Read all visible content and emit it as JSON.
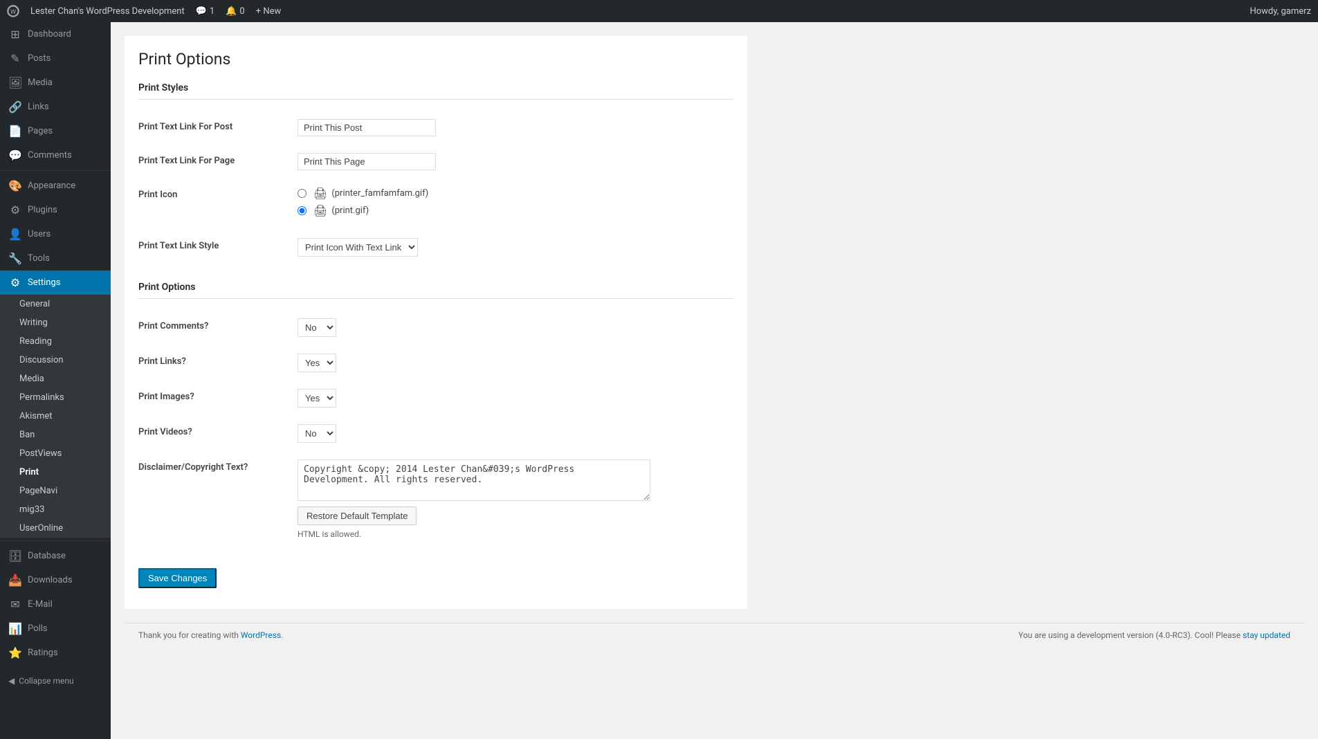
{
  "adminbar": {
    "site_name": "Lester Chan's WordPress Development",
    "comments_count": "1",
    "updates_count": "0",
    "new_label": "+ New",
    "howdy": "Howdy, gamerz"
  },
  "sidebar": {
    "menu_items": [
      {
        "id": "dashboard",
        "label": "Dashboard",
        "icon": "⊞"
      },
      {
        "id": "posts",
        "label": "Posts",
        "icon": "✎"
      },
      {
        "id": "media",
        "label": "Media",
        "icon": "⬜"
      },
      {
        "id": "links",
        "label": "Links",
        "icon": "🔗"
      },
      {
        "id": "pages",
        "label": "Pages",
        "icon": "📄"
      },
      {
        "id": "comments",
        "label": "Comments",
        "icon": "💬"
      },
      {
        "id": "appearance",
        "label": "Appearance",
        "icon": "🎨"
      },
      {
        "id": "plugins",
        "label": "Plugins",
        "icon": "⚙"
      },
      {
        "id": "users",
        "label": "Users",
        "icon": "👤"
      },
      {
        "id": "tools",
        "label": "Tools",
        "icon": "🔧"
      },
      {
        "id": "settings",
        "label": "Settings",
        "icon": "⚙",
        "active": true
      }
    ],
    "settings_submenu": [
      {
        "id": "general",
        "label": "General"
      },
      {
        "id": "writing",
        "label": "Writing"
      },
      {
        "id": "reading",
        "label": "Reading"
      },
      {
        "id": "discussion",
        "label": "Discussion"
      },
      {
        "id": "media",
        "label": "Media"
      },
      {
        "id": "permalinks",
        "label": "Permalinks"
      },
      {
        "id": "akismet",
        "label": "Akismet"
      },
      {
        "id": "ban",
        "label": "Ban"
      },
      {
        "id": "postviews",
        "label": "PostViews"
      },
      {
        "id": "print",
        "label": "Print",
        "current": true
      },
      {
        "id": "pagenavi",
        "label": "PageNavi"
      },
      {
        "id": "mig33",
        "label": "mig33"
      },
      {
        "id": "useronline",
        "label": "UserOnline"
      }
    ],
    "bottom_items": [
      {
        "id": "database",
        "label": "Database",
        "icon": "🗄"
      },
      {
        "id": "downloads",
        "label": "Downloads",
        "icon": "📥"
      },
      {
        "id": "email",
        "label": "E-Mail",
        "icon": "✉"
      },
      {
        "id": "polls",
        "label": "Polls",
        "icon": "📊"
      },
      {
        "id": "ratings",
        "label": "Ratings",
        "icon": "⭐"
      }
    ],
    "collapse_label": "Collapse menu"
  },
  "page": {
    "title": "Print Options",
    "print_styles_heading": "Print Styles",
    "print_options_heading": "Print Options",
    "fields": {
      "text_link_post_label": "Print Text Link For Post",
      "text_link_post_value": "Print This Post",
      "text_link_page_label": "Print Text Link For Page",
      "text_link_page_value": "Print This Page",
      "print_icon_label": "Print Icon",
      "icon_option1_label": "(printer_famfamfam.gif)",
      "icon_option2_label": "(print.gif)",
      "text_link_style_label": "Print Text Link Style",
      "text_link_style_value": "Print Icon With Text Link",
      "print_comments_label": "Print Comments?",
      "print_comments_value": "No",
      "print_links_label": "Print Links?",
      "print_links_value": "Yes",
      "print_images_label": "Print Images?",
      "print_images_value": "Yes",
      "print_videos_label": "Print Videos?",
      "print_videos_value": "No",
      "disclaimer_label": "Disclaimer/Copyright Text?",
      "disclaimer_value": "Copyright &copy; 2014 Lester Chan&#039;s WordPress Development. All rights reserved.",
      "html_note": "HTML is allowed.",
      "restore_button": "Restore Default Template",
      "save_button": "Save Changes"
    }
  },
  "footer": {
    "left_text": "Thank you for creating with ",
    "wp_link_text": "WordPress",
    "right_text": "You are using a development version (4.0-RC3). Cool! Please ",
    "stay_updated_text": "stay updated"
  }
}
